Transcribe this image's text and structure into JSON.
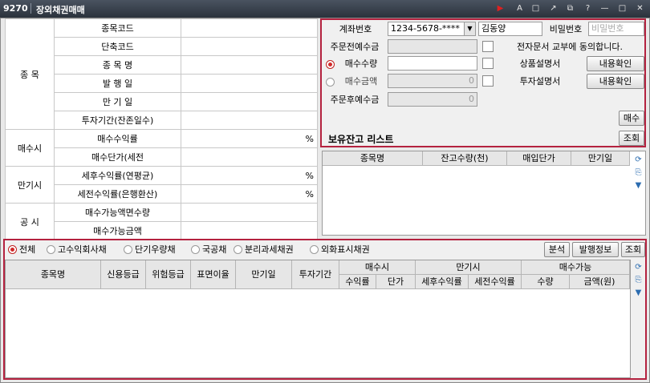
{
  "titlebar": {
    "code": "9270",
    "title": "장외채권매매",
    "icons": [
      "play-icon",
      "font-icon",
      "window-icon",
      "link-icon",
      "restore-icon",
      "help-icon",
      "minimize-icon",
      "maximize-icon",
      "close-icon"
    ],
    "glyphs": [
      "▶",
      "A",
      "□",
      "↗",
      "⧉",
      "?",
      "—",
      "□",
      "✕"
    ]
  },
  "info": {
    "groups": {
      "item": "종 목",
      "buy": "매수시",
      "maturity": "만기시",
      "notice": "공 시"
    },
    "rows": [
      {
        "label": "종목코드",
        "value": ""
      },
      {
        "label": "단축코드",
        "value": ""
      },
      {
        "label": "종 목 명",
        "value": ""
      },
      {
        "label": "발 행 일",
        "value": ""
      },
      {
        "label": "만 기 일",
        "value": ""
      },
      {
        "label": "투자기간(잔존일수)",
        "value": ""
      },
      {
        "label": "매수수익률",
        "value": "%"
      },
      {
        "label": "매수단가(세전",
        "value": ""
      },
      {
        "label": "세후수익률(연평균)",
        "value": "%"
      },
      {
        "label": "세전수익률(은행환산)",
        "value": "%"
      },
      {
        "label": "매수가능액면수량",
        "value": ""
      },
      {
        "label": "매수가능금액",
        "value": ""
      }
    ]
  },
  "order": {
    "account_label": "계좌번호",
    "account_value": "1234-5678-****",
    "account_name": "김동양",
    "password_label": "비밀번호",
    "password_placeholder": "비밀번호",
    "pre_deposit_label": "주문전예수금",
    "electronic_doc": "전자문서 교부에 동의합니다.",
    "qty_label": "매수수량",
    "qty_value": "",
    "amount_label": "매수금액",
    "amount_value": "0",
    "post_deposit_label": "주문후예수금",
    "post_deposit_value": "0",
    "product_doc": "상품설명서",
    "invest_doc": "투자설명서",
    "confirm_label": "내용확인",
    "buy_button": "매수",
    "holdings_title": "보유잔고 리스트",
    "query_button": "조회"
  },
  "holdings": {
    "columns": [
      "종목명",
      "잔고수량(천)",
      "매입단가",
      "만기일"
    ]
  },
  "filters": {
    "options": [
      "전체",
      "고수익회사채",
      "단기우량채",
      "국공채",
      "분리과세채권",
      "외화표시채권"
    ],
    "selected": "전체",
    "analysis_button": "분석",
    "issue_info_button": "발행정보",
    "query_button": "조회"
  },
  "grid": {
    "columns": [
      "종목명",
      "신용등급",
      "위험등급",
      "표면이율",
      "만기일",
      "투자기간"
    ],
    "group_buy": "매수시",
    "buy_sub": [
      "수익률",
      "단가"
    ],
    "group_maturity": "만기시",
    "maturity_sub": [
      "세후수익률",
      "세전수익률"
    ],
    "group_available": "매수가능",
    "available_sub": [
      "수량",
      "금액(원)"
    ]
  }
}
